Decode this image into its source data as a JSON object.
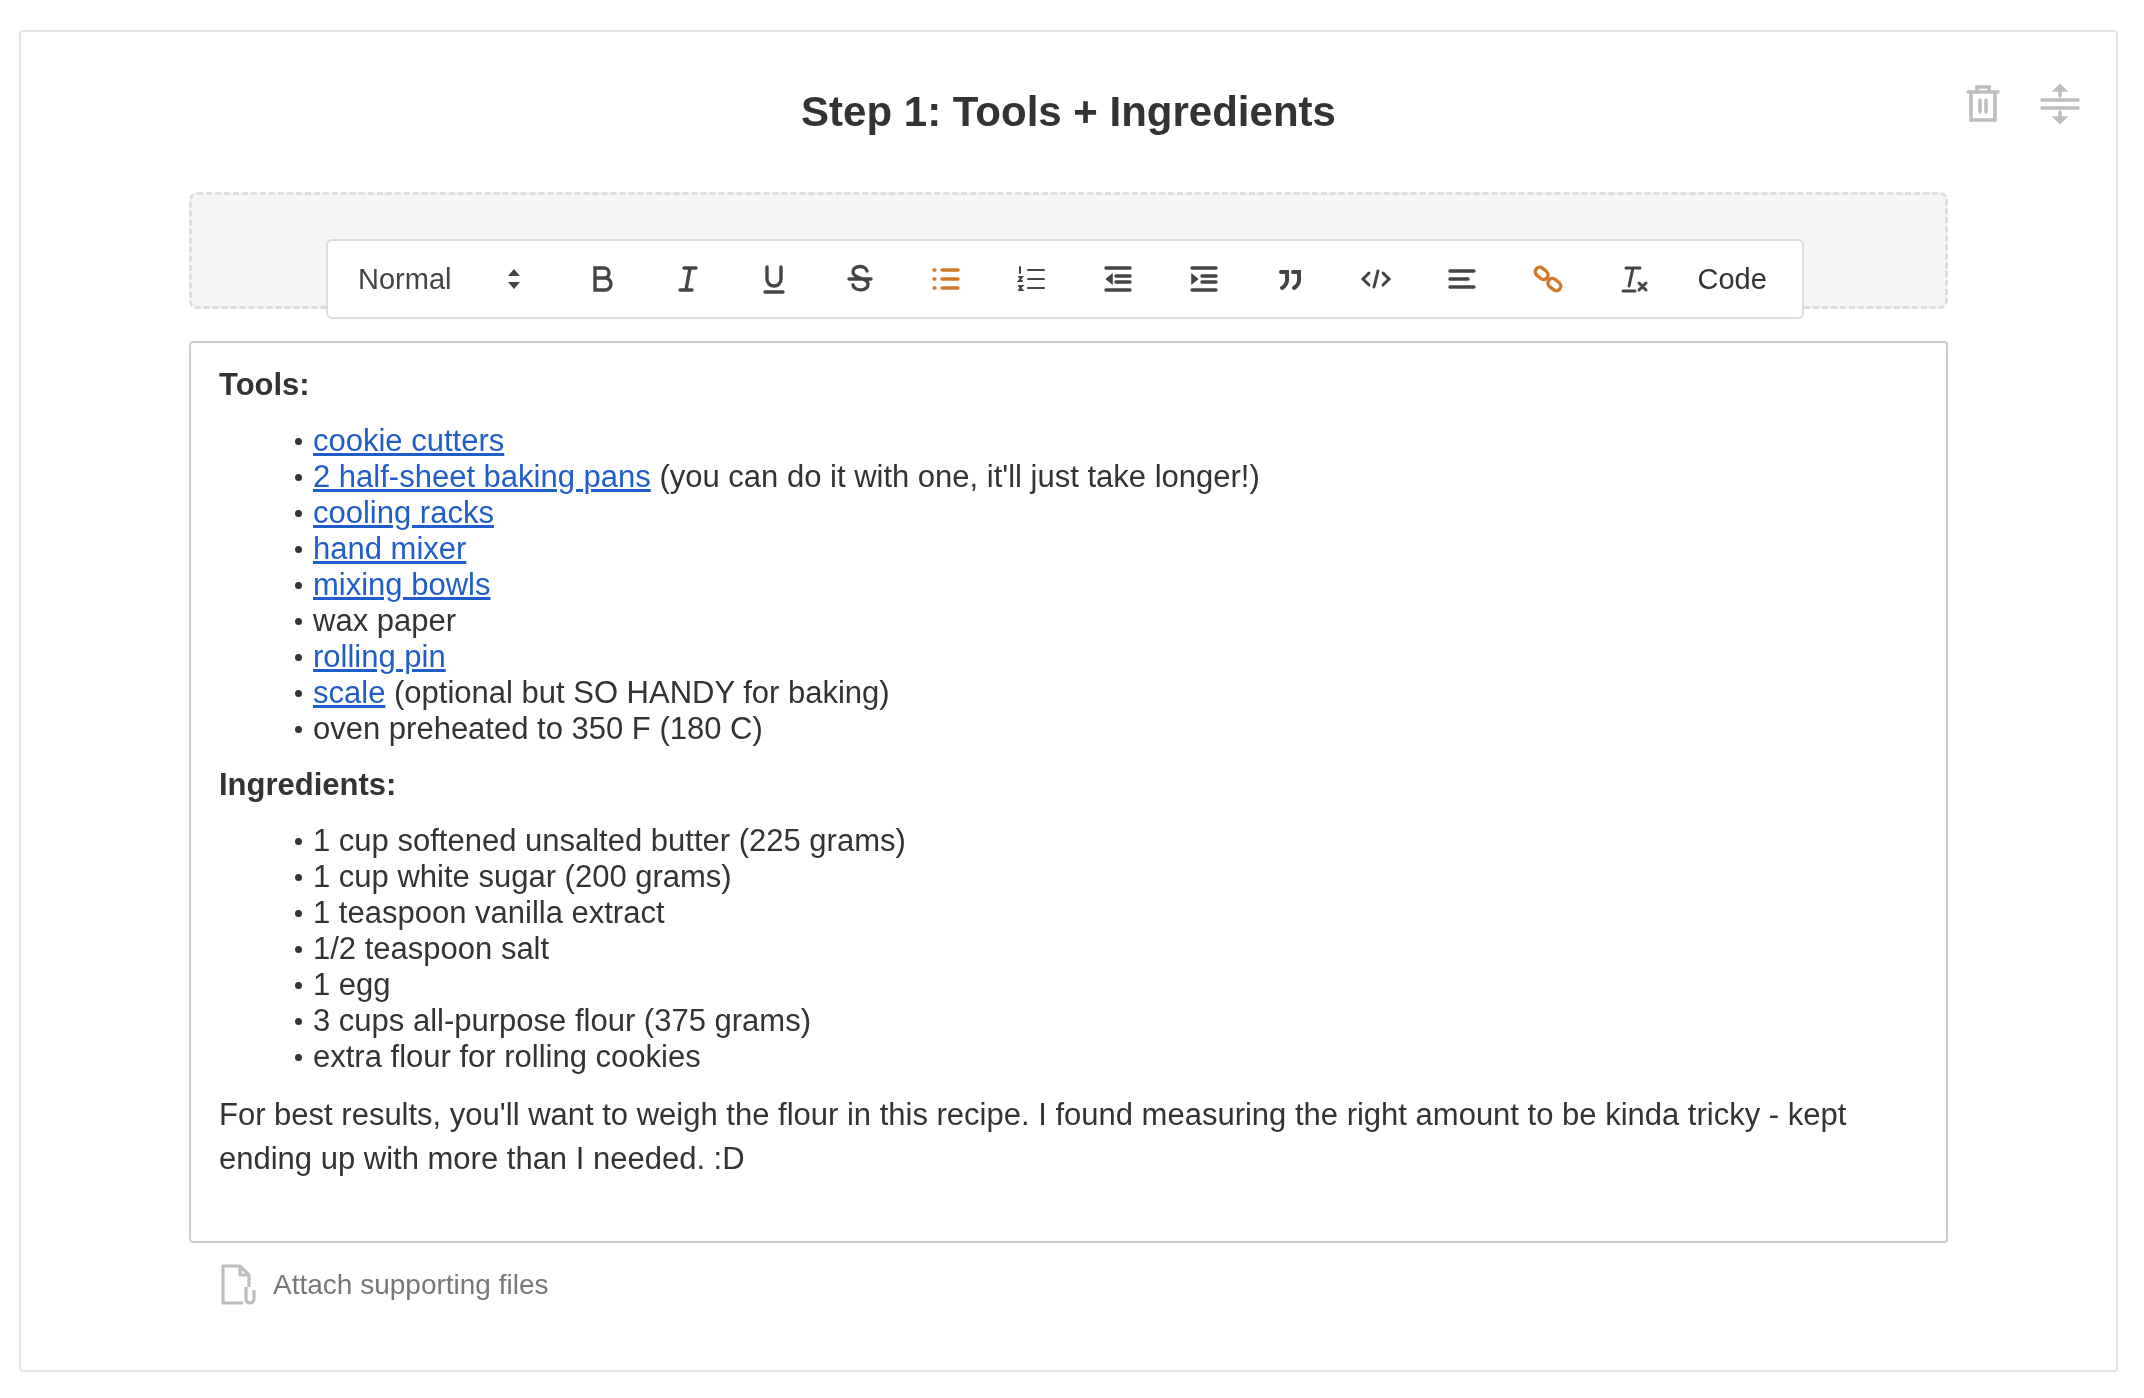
{
  "title": "Step 1: Tools + Ingredients",
  "toolbar": {
    "format": "Normal",
    "buttons": [
      {
        "kind": "bold",
        "active": false
      },
      {
        "kind": "italic",
        "active": false
      },
      {
        "kind": "underline",
        "active": false
      },
      {
        "kind": "strike",
        "active": false
      },
      {
        "kind": "bullet-list",
        "active": true
      },
      {
        "kind": "ordered-list",
        "active": false
      },
      {
        "kind": "outdent",
        "active": false
      },
      {
        "kind": "indent",
        "active": false
      },
      {
        "kind": "quote",
        "active": false
      },
      {
        "kind": "code-tag",
        "active": false
      },
      {
        "kind": "align",
        "active": false
      },
      {
        "kind": "link",
        "active": true
      },
      {
        "kind": "clear-format",
        "active": false
      }
    ],
    "code_button": "Code"
  },
  "content": [
    {
      "kind": "heading",
      "text": "Tools:"
    },
    {
      "kind": "list",
      "items": [
        {
          "link": "cookie cutters"
        },
        {
          "link": "2 half-sheet baking pans",
          "text": " (you can do it with one, it'll just take longer!)"
        },
        {
          "link": "cooling racks"
        },
        {
          "link": "hand mixer"
        },
        {
          "link": "mixing bowls"
        },
        {
          "text": "wax paper"
        },
        {
          "link": "rolling pin"
        },
        {
          "link": "scale",
          "text": " (optional but SO HANDY for baking)"
        },
        {
          "text": "oven preheated to 350 F (180 C)"
        }
      ]
    },
    {
      "kind": "heading",
      "text": "Ingredients:"
    },
    {
      "kind": "list",
      "items": [
        {
          "text": "1 cup softened unsalted butter (225 grams)"
        },
        {
          "text": "1 cup white sugar (200 grams)"
        },
        {
          "text": "1 teaspoon vanilla extract"
        },
        {
          "text": "1/2 teaspoon salt"
        },
        {
          "text": "1 egg"
        },
        {
          "text": "3 cups all-purpose flour (375 grams)"
        },
        {
          "text": "extra flour for rolling cookies"
        }
      ]
    },
    {
      "kind": "paragraph",
      "text": "For best results, you'll want to weigh the flour in this recipe. I found measuring the right amount to be kinda tricky - kept ending up with more than I needed. :D"
    }
  ],
  "attach": "Attach supporting files"
}
